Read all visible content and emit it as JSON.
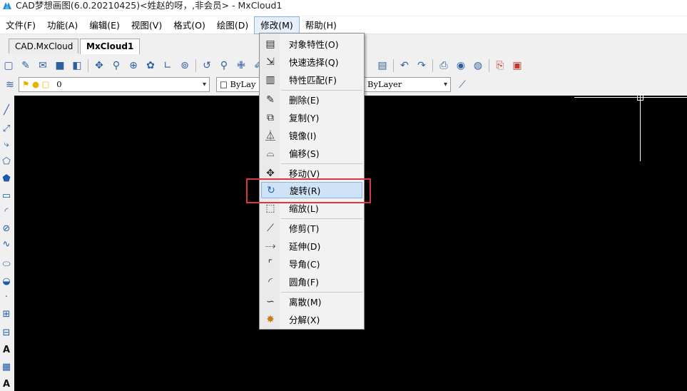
{
  "window": {
    "title": "CAD梦想画图(6.0.20210425)<姓赵的呀，,非会员> - MxCloud1",
    "app_icon": "cad-app-icon"
  },
  "menubar": {
    "items": [
      {
        "label": "文件(F)",
        "name": "menu-file"
      },
      {
        "label": "功能(A)",
        "name": "menu-function"
      },
      {
        "label": "编辑(E)",
        "name": "menu-edit"
      },
      {
        "label": "视图(V)",
        "name": "menu-view"
      },
      {
        "label": "格式(O)",
        "name": "menu-format"
      },
      {
        "label": "绘图(D)",
        "name": "menu-draw"
      },
      {
        "label": "修改(M)",
        "name": "menu-modify"
      },
      {
        "label": "帮助(H)",
        "name": "menu-help"
      }
    ],
    "active": "修改(M)"
  },
  "tabs": [
    {
      "label": "CAD.MxCloud"
    },
    {
      "label": "MxCloud1",
      "active": true
    }
  ],
  "layerbar": {
    "layer_value": "0",
    "color_value": "ByLay",
    "lineweight_value": "ByLayer"
  },
  "modify_menu": {
    "items": [
      {
        "label": "对象特性(O)",
        "icon": "object-properties-icon"
      },
      {
        "label": "快速选择(Q)",
        "icon": "quick-select-icon"
      },
      {
        "label": "特性匹配(F)",
        "icon": "match-properties-icon"
      },
      {
        "label": "删除(E)",
        "icon": "erase-icon"
      },
      {
        "label": "复制(Y)",
        "icon": "copy-icon"
      },
      {
        "label": "镜像(I)",
        "icon": "mirror-icon"
      },
      {
        "label": "偏移(S)",
        "icon": "offset-icon"
      },
      {
        "label": "移动(V)",
        "icon": "move-icon"
      },
      {
        "label": "旋转(R)",
        "icon": "rotate-icon",
        "highlighted": true
      },
      {
        "label": "缩放(L)",
        "icon": "scale-icon"
      },
      {
        "label": "修剪(T)",
        "icon": "trim-icon"
      },
      {
        "label": "延伸(D)",
        "icon": "extend-icon"
      },
      {
        "label": "导角(C)",
        "icon": "chamfer-icon"
      },
      {
        "label": "圆角(F)",
        "icon": "fillet-icon"
      },
      {
        "label": "离散(M)",
        "icon": "explode-discrete-icon"
      },
      {
        "label": "分解(X)",
        "icon": "decompose-icon"
      }
    ]
  },
  "colors": {
    "canvas": "#000000",
    "highlight": "#cfe3f6",
    "annotation_box": "#d9383f"
  }
}
